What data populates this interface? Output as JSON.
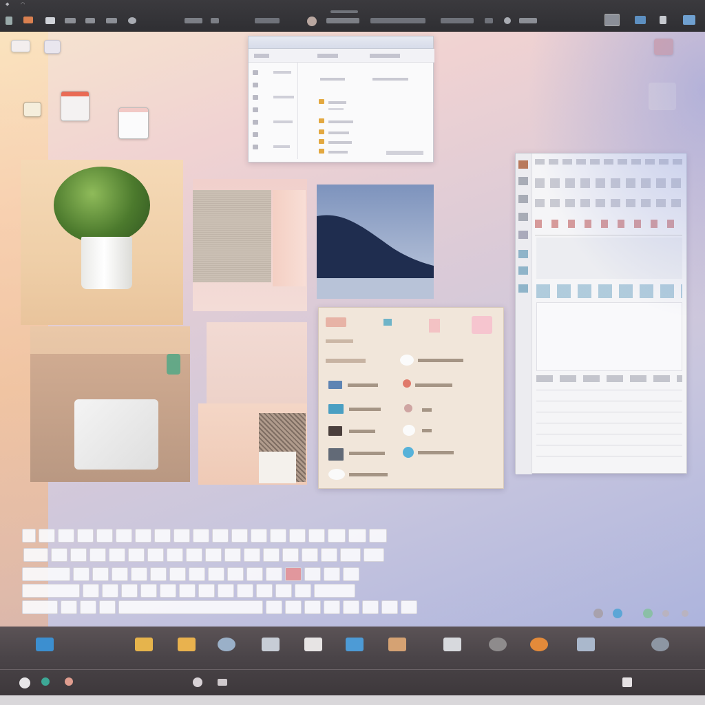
{
  "topbar": {
    "menu_left": [
      "",
      "",
      "",
      "",
      "",
      ""
    ],
    "center_title": "",
    "items": [
      "",
      "",
      "",
      "",
      "",
      "",
      ""
    ]
  },
  "finder_window": {
    "title": "",
    "rows_left": [
      "",
      "",
      "",
      "",
      "",
      "",
      ""
    ],
    "rows_right": [
      "",
      "",
      "",
      "",
      "",
      ""
    ]
  },
  "apps_panel": {
    "items": [
      "",
      "",
      "",
      "",
      "",
      "",
      "",
      "",
      "",
      ""
    ]
  },
  "keyboard": {
    "rows": [
      [
        "",
        "",
        "",
        "",
        "",
        "",
        "",
        "",
        "",
        "",
        "",
        "",
        "",
        "",
        "",
        "",
        "",
        "",
        ""
      ],
      [
        "",
        "",
        "",
        "",
        "",
        "",
        "",
        "",
        "",
        "",
        "",
        "",
        "",
        "",
        "",
        "",
        "",
        ""
      ],
      [
        "",
        "",
        "",
        "",
        "",
        "",
        "",
        "",
        "",
        "",
        "",
        "",
        "",
        "",
        "",
        ""
      ],
      [
        "",
        "",
        "",
        "",
        "",
        "",
        "",
        "",
        "",
        "",
        "",
        "",
        "",
        ""
      ],
      [
        "",
        "",
        "",
        "",
        "",
        "",
        "",
        "",
        "",
        "",
        "",
        "",
        ""
      ]
    ]
  },
  "dock": {
    "items": [
      {
        "icon": "monitor-icon",
        "label": ""
      },
      {
        "icon": "folder-icon",
        "label": ""
      },
      {
        "icon": "folder-icon",
        "label": ""
      },
      {
        "icon": "search-icon",
        "label": ""
      },
      {
        "icon": "photo-icon",
        "label": ""
      },
      {
        "icon": "calendar-icon",
        "label": ""
      },
      {
        "icon": "app-icon",
        "label": ""
      },
      {
        "icon": "gallery-icon",
        "label": ""
      },
      {
        "icon": "screen-icon",
        "label": ""
      },
      {
        "icon": "drop-icon",
        "label": ""
      },
      {
        "icon": "orange-ball-icon",
        "label": ""
      },
      {
        "icon": "display-icon",
        "label": ""
      },
      {
        "icon": "globe-icon",
        "label": ""
      }
    ]
  },
  "colors": {
    "desktop_left": "#f6e4cf",
    "desktop_right": "#adb4dd",
    "dock": "#4a4448",
    "topbar": "#333236"
  }
}
